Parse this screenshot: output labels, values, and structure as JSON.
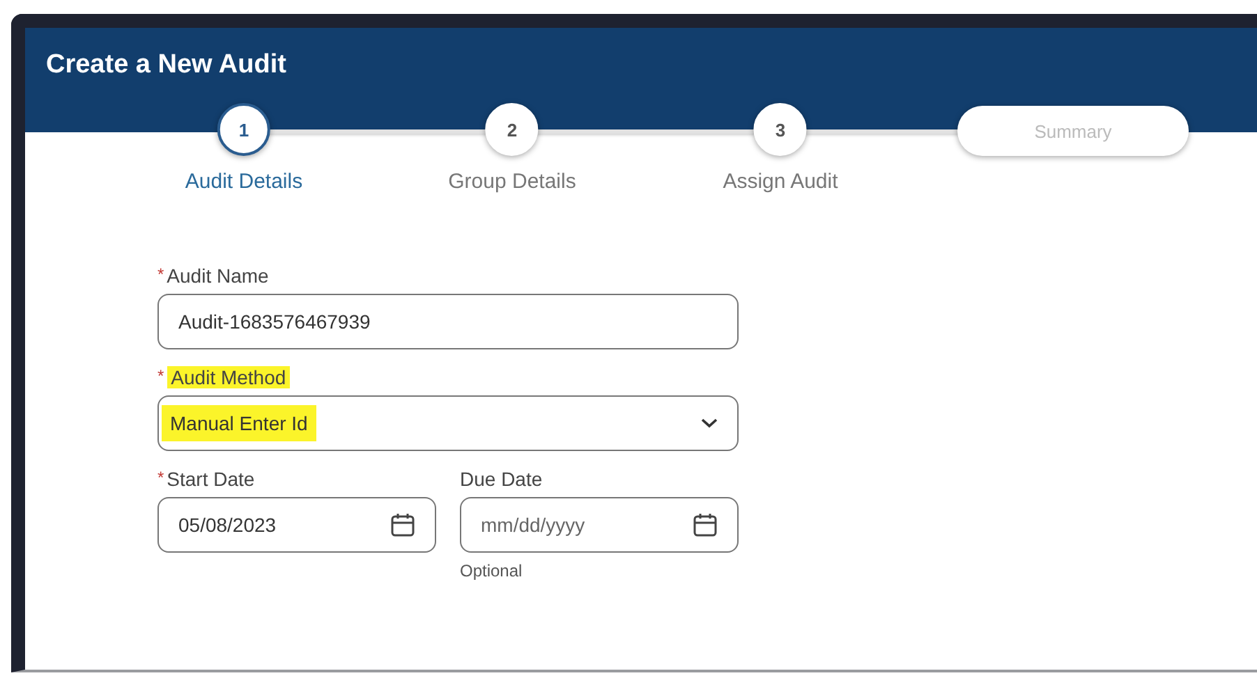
{
  "window": {
    "title": "Create a New Audit"
  },
  "steps": [
    {
      "kind": "circle",
      "number": "1",
      "label": "Audit Details",
      "selected": true
    },
    {
      "kind": "circle",
      "number": "2",
      "label": "Group Details",
      "selected": false
    },
    {
      "kind": "circle",
      "number": "3",
      "label": "Assign Audit",
      "selected": false
    },
    {
      "kind": "pill",
      "number": "Summary",
      "selected": false
    }
  ],
  "audit_name": {
    "required_mark": "*",
    "label": "Audit Name",
    "value": "Audit-1683576467939"
  },
  "audit_method": {
    "required_mark": "*",
    "label": "Audit Method",
    "value": "Manual Enter Id",
    "highlighted": true
  },
  "start_date": {
    "required_mark": "*",
    "label": "Start Date",
    "value": "05/08/2023"
  },
  "due_date": {
    "label": "Due Date",
    "placeholder": "mm/dd/yyyy",
    "hint": "Optional"
  }
}
